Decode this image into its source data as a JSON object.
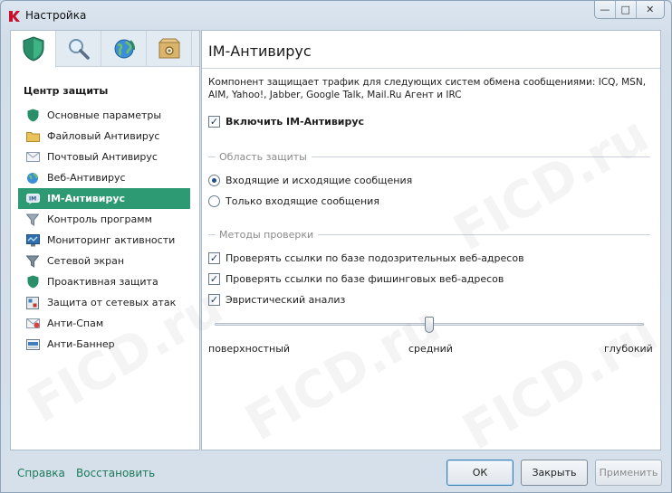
{
  "window": {
    "title": "Настройка",
    "minimize": "—",
    "maximize": "□",
    "close": "✕"
  },
  "sidebar": {
    "tabs": [
      {
        "name": "shield-tab",
        "icon": "shield-icon"
      },
      {
        "name": "search-tab",
        "icon": "magnifier-icon"
      },
      {
        "name": "globe-tab",
        "icon": "globe-icon"
      },
      {
        "name": "box-tab",
        "icon": "gear-box-icon"
      }
    ],
    "section_title": "Центр защиты",
    "items": [
      {
        "label": "Основные параметры",
        "icon": "shield-icon"
      },
      {
        "label": "Файловый Антивирус",
        "icon": "folder-icon"
      },
      {
        "label": "Почтовый Антивирус",
        "icon": "envelope-icon"
      },
      {
        "label": "Веб-Антивирус",
        "icon": "globe-icon"
      },
      {
        "label": "IM-Антивирус",
        "icon": "im-icon"
      },
      {
        "label": "Контроль программ",
        "icon": "funnel-icon"
      },
      {
        "label": "Мониторинг активности",
        "icon": "monitor-icon"
      },
      {
        "label": "Сетевой экран",
        "icon": "firewall-icon"
      },
      {
        "label": "Проактивная защита",
        "icon": "shield-icon"
      },
      {
        "label": "Защита от сетевых атак",
        "icon": "network-attack-icon"
      },
      {
        "label": "Анти-Спам",
        "icon": "antispam-icon"
      },
      {
        "label": "Анти-Баннер",
        "icon": "antibanner-icon"
      }
    ],
    "active_index": 4
  },
  "main": {
    "title": "IM-Антивирус",
    "description": "Компонент защищает трафик для следующих систем обмена сообщениями: ICQ, MSN, AIM, Yahoo!, Jabber, Google Talk, Mail.Ru Агент и IRC",
    "enable_label": "Включить IM-Антивирус",
    "enable_checked": true,
    "scope_group": "Область защиты",
    "scope_options": [
      {
        "label": "Входящие и исходящие сообщения",
        "selected": true
      },
      {
        "label": "Только входящие сообщения",
        "selected": false
      }
    ],
    "methods_group": "Методы проверки",
    "methods": [
      {
        "label": "Проверять ссылки по базе подозрительных веб-адресов",
        "checked": true
      },
      {
        "label": "Проверять ссылки по базе фишинговых веб-адресов",
        "checked": true
      },
      {
        "label": "Эвристический анализ",
        "checked": true
      }
    ],
    "slider": {
      "labels": [
        "поверхностный",
        "средний",
        "глубокий"
      ],
      "value": "средний",
      "position_fraction": 0.5
    }
  },
  "footer": {
    "help": "Справка",
    "restore": "Восстановить",
    "ok": "ОК",
    "close": "Закрыть",
    "apply": "Применить"
  },
  "watermark": "FICD.ru",
  "colors": {
    "accent": "#2e9a73",
    "link": "#1b7a58"
  }
}
